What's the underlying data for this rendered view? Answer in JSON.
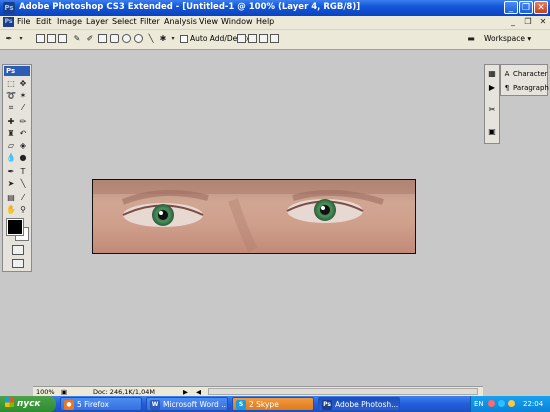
{
  "window": {
    "title": "Adobe Photoshop CS3 Extended - [Untitled-1 @ 100% (Layer 4, RGB/8)]",
    "app_badge": "Ps",
    "controls": [
      "_",
      "❐",
      "✕"
    ]
  },
  "menubar": {
    "items": [
      "File",
      "Edit",
      "Image",
      "Layer",
      "Select",
      "Filter",
      "Analysis",
      "View",
      "Window",
      "Help"
    ],
    "doc_controls": [
      "_",
      "❐",
      "✕"
    ]
  },
  "options_bar": {
    "auto_add_delete_label": "Auto Add/Delete",
    "workspace_label": "Workspace ▾"
  },
  "toolbox": {
    "badge": "Ps",
    "foreground_color": "#000000",
    "background_color": "#ffffff"
  },
  "panels": {
    "items": [
      {
        "icon": "A",
        "label": "Character"
      },
      {
        "icon": "¶",
        "label": "Paragraph"
      }
    ]
  },
  "status_bar": {
    "zoom": "100%",
    "doc_info": "Doc: 246,1K/1,04M"
  },
  "taskbar": {
    "start_label": "пуск",
    "tasks": [
      {
        "label": "5 Firefox",
        "icon": "firefox-icon"
      },
      {
        "label": "Microsoft Word ...",
        "icon": "word-icon"
      },
      {
        "label": "2 Skype",
        "icon": "skype-icon"
      },
      {
        "label": "Adobe Photosh...",
        "icon": "photoshop-icon"
      }
    ],
    "language": "EN",
    "clock": "22:04"
  },
  "colors": {
    "iris": "#4a8f5a",
    "skin": "#cfa08c",
    "taskbar": "#245edc"
  }
}
